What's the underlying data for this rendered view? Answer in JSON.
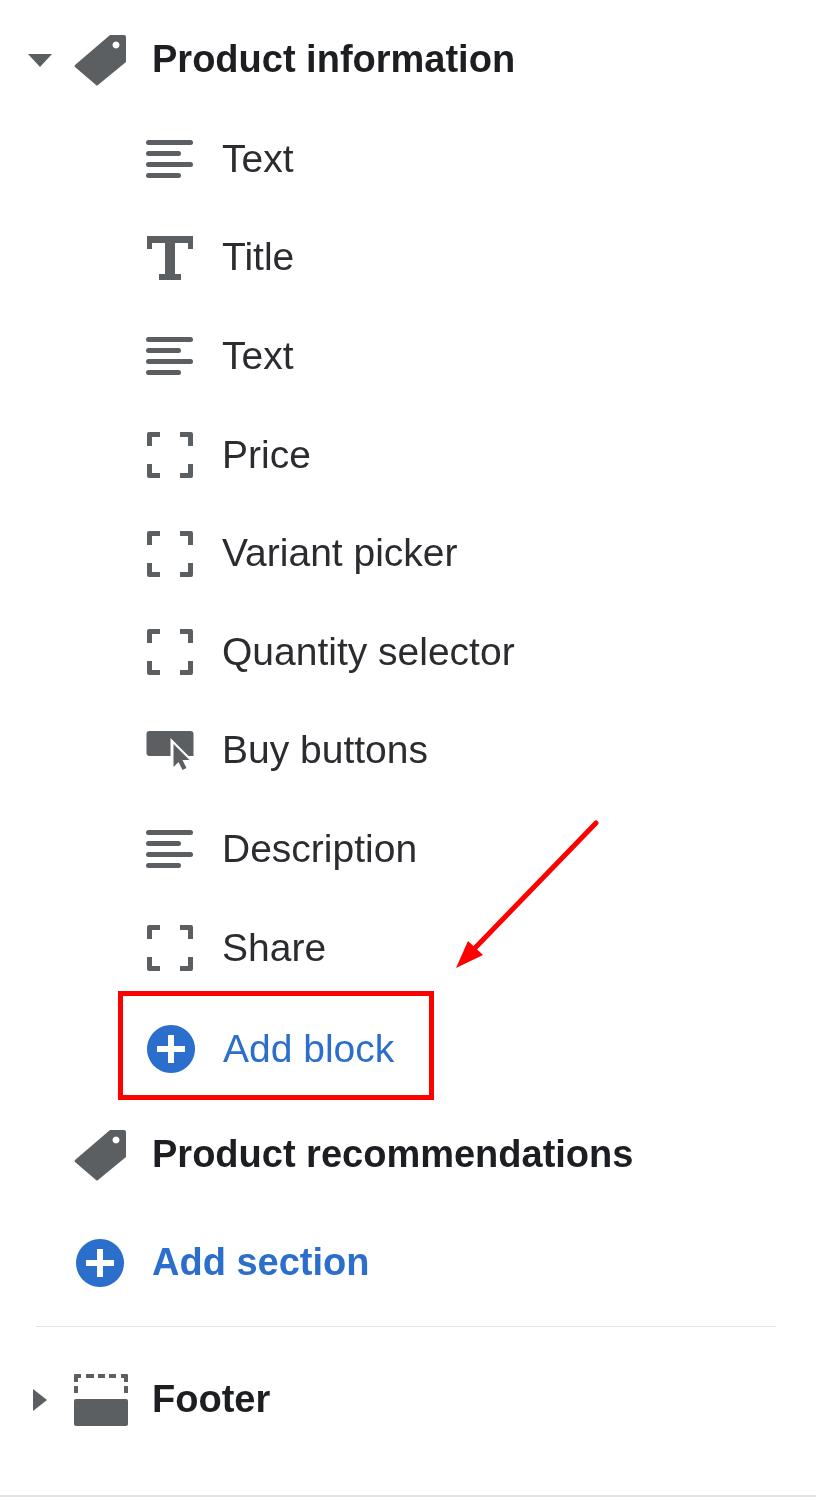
{
  "sections": [
    {
      "kind": "product",
      "label": "Product information",
      "expanded": true,
      "blocks": [
        {
          "kind": "text",
          "label": "Text"
        },
        {
          "kind": "heading",
          "label": "Title"
        },
        {
          "kind": "text",
          "label": "Text"
        },
        {
          "kind": "generic",
          "label": "Price"
        },
        {
          "kind": "generic",
          "label": "Variant picker"
        },
        {
          "kind": "generic",
          "label": "Quantity selector"
        },
        {
          "kind": "button",
          "label": "Buy buttons"
        },
        {
          "kind": "text",
          "label": "Description"
        },
        {
          "kind": "generic",
          "label": "Share"
        }
      ],
      "add_block": {
        "label": "Add block",
        "highlighted": true,
        "callout": true
      }
    },
    {
      "kind": "product",
      "label": "Product recommendations"
    }
  ],
  "add_section": {
    "label": "Add section"
  },
  "footer_sections": [
    {
      "kind": "footer",
      "label": "Footer",
      "expanded": false
    }
  ]
}
